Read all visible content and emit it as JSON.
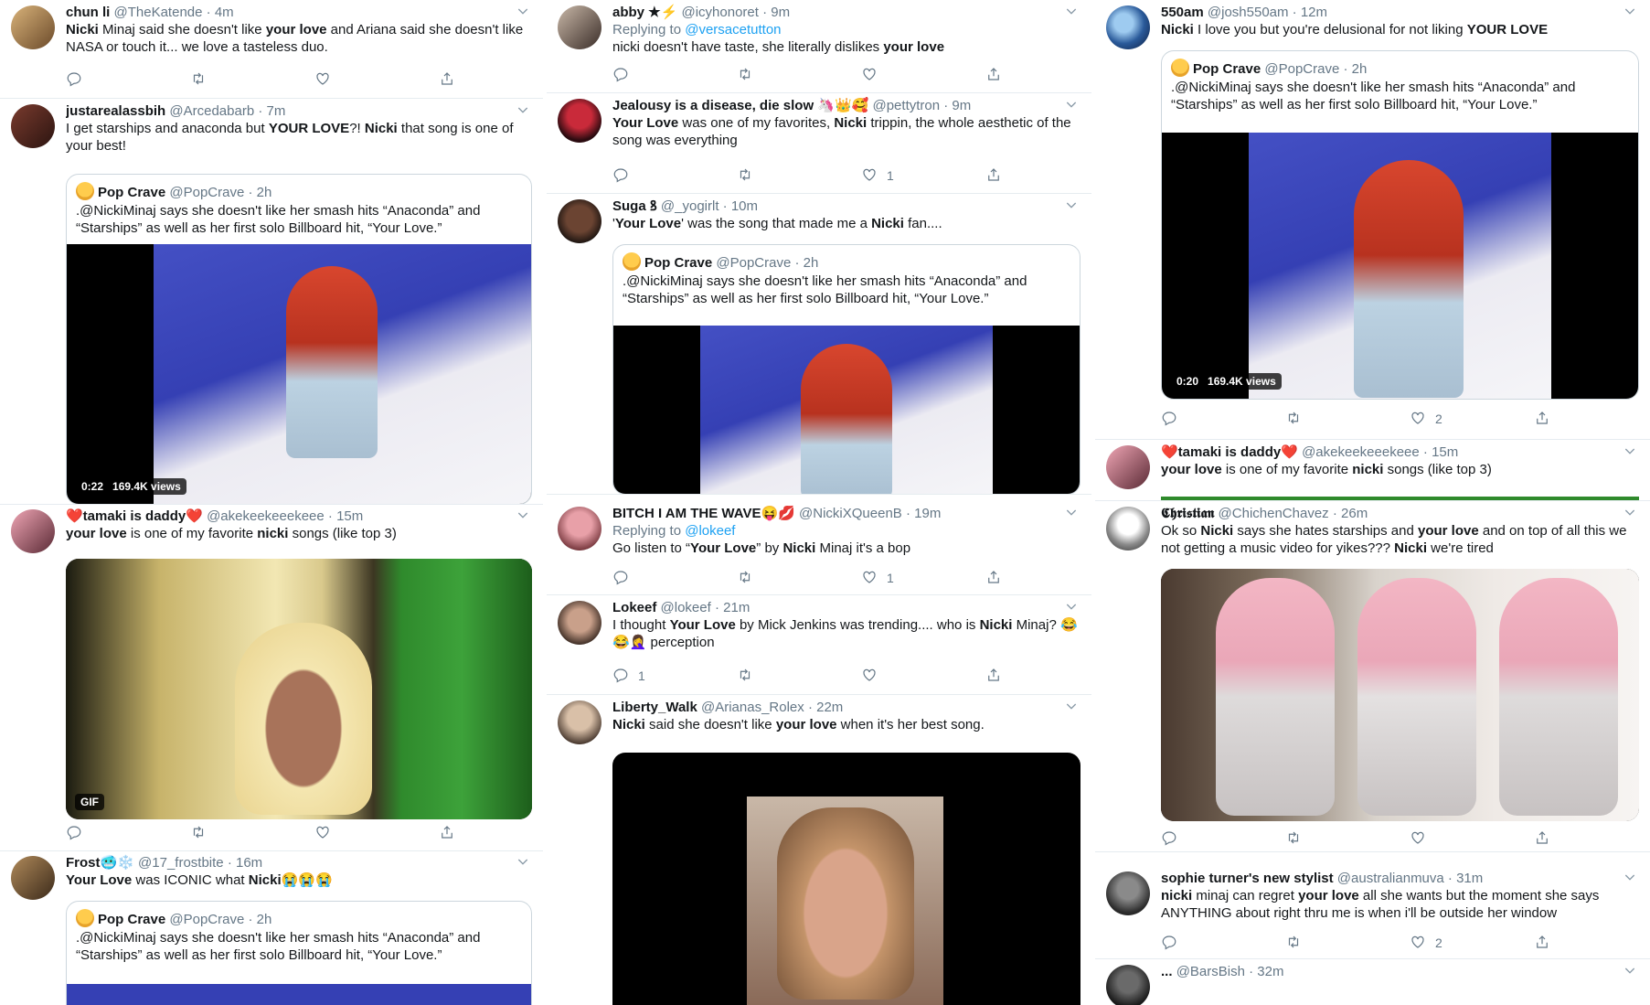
{
  "columns": [
    {
      "tweets": [
        {
          "name": "chun li",
          "handle": "@TheKatende",
          "time": "4m",
          "text": "Nicki Minaj said she doesn't like your love and Ariana said she doesn't like NASA or touch it... we love a tasteless duo.",
          "bold": [
            "Nicki",
            "your love"
          ]
        },
        {
          "name": "justarealassbih",
          "handle": "@Arcedabarb",
          "time": "7m",
          "text": "I get starships and anaconda but YOUR LOVE?! Nicki that song is one of your best!",
          "bold": [
            "YOUR LOVE",
            "Nicki"
          ],
          "quote": {
            "name": "Pop Crave",
            "handle": "@PopCrave",
            "time": "2h",
            "text": ".@NickiMinaj says she doesn't like her smash hits “Anaconda” and “Starships” as well as her first solo Billboard hit, “Your Love.”"
          },
          "media": {
            "badge_time": "0:22",
            "badge_views": "169.4K views"
          }
        },
        {
          "name": "❤️tamaki is daddy❤️",
          "handle": "@akekeekeeekeee",
          "time": "15m",
          "text": "your love is one of my favorite nicki songs (like top 3)",
          "bold": [
            "your love",
            "nicki"
          ],
          "media": {
            "badge": "GIF"
          }
        },
        {
          "name": "Frost🥶❄️",
          "handle": "@17_frostbite",
          "time": "16m",
          "text": "Your Love was ICONIC what Nicki😭😭😭",
          "bold": [
            "Your Love",
            "Nicki"
          ],
          "quote": {
            "name": "Pop Crave",
            "handle": "@PopCrave",
            "time": "2h",
            "text": ".@NickiMinaj says she doesn't like her smash hits “Anaconda” and “Starships” as well as her first solo Billboard hit, “Your Love.”"
          }
        }
      ]
    },
    {
      "tweets": [
        {
          "name": "abby ★⚡",
          "handle": "@icyhonoret",
          "time": "9m",
          "reply": "@versacetutton",
          "text": "nicki doesn't have taste, she literally dislikes your love",
          "bold": [
            "your love"
          ]
        },
        {
          "name": "Jealousy is a disease, die slow 🦄👑🥰",
          "handle": "@pettytron",
          "time": "9m",
          "text": "Your Love was one of my favorites, Nicki trippin, the whole aesthetic of the song was everything",
          "bold": [
            "Your Love",
            "Nicki"
          ],
          "likes": "1"
        },
        {
          "name": "Suga ꝸ",
          "handle": "@_yogirlt",
          "time": "10m",
          "text": "'Your Love' was the song that made me a Nicki fan....",
          "bold": [
            "Your Love",
            "Nicki"
          ],
          "quote": {
            "name": "Pop Crave",
            "handle": "@PopCrave",
            "time": "2h",
            "text": ".@NickiMinaj says she doesn't like her smash hits “Anaconda” and “Starships” as well as her first solo Billboard hit, “Your Love.”"
          }
        },
        {
          "name": "BITCH I AM THE WAVE😝💋",
          "handle": "@NickiXQueenB",
          "time": "19m",
          "reply": "@lokeef",
          "text": "Go listen to “Your Love” by Nicki Minaj it's a bop",
          "bold": [
            "Your Love",
            "Nicki"
          ],
          "likes": "1"
        },
        {
          "name": "Lokeef",
          "handle": "@lokeef",
          "time": "21m",
          "text": "I thought Your Love by Mick Jenkins was trending.... who is Nicki Minaj? 😂 😂🤦‍♀️ perception",
          "bold": [
            "Your Love",
            "Nicki"
          ],
          "replies": "1"
        },
        {
          "name": "Liberty_Walk",
          "handle": "@Arianas_Rolex",
          "time": "22m",
          "text": "Nicki said she doesn't like your love when it's her best song.",
          "bold": [
            "Nicki",
            "your love"
          ]
        }
      ]
    },
    {
      "tweets": [
        {
          "name": "550am",
          "handle": "@josh550am",
          "time": "12m",
          "text": "Nicki I love you but you're delusional for not liking YOUR LOVE",
          "bold": [
            "Nicki",
            "YOUR LOVE"
          ],
          "quote": {
            "name": "Pop Crave",
            "handle": "@PopCrave",
            "time": "2h",
            "text": ".@NickiMinaj says she doesn't like her smash hits “Anaconda” and “Starships” as well as her first solo Billboard hit, “Your Love.”"
          },
          "media": {
            "badge_time": "0:20",
            "badge_views": "169.4K views"
          },
          "likes": "2"
        },
        {
          "name": "❤️tamaki is daddy❤️",
          "handle": "@akekeekeeekeee",
          "time": "15m",
          "text": "your love is one of my favorite nicki songs (like top 3)",
          "bold": [
            "your love",
            "nicki"
          ]
        },
        {
          "name": "𝕮𝖍𝖗𝖎𝖘𝖙𝖎𝖆𝖓",
          "handle": "@ChichenChavez",
          "time": "26m",
          "text": "Ok so Nicki says she hates starships and your love and on top of all this we not getting a music video for yikes??? Nicki we're tired",
          "bold": [
            "Nicki",
            "your love"
          ]
        },
        {
          "name": "sophie turner's new stylist",
          "handle": "@australianmuva",
          "time": "31m",
          "text": "nicki minaj can regret your love all she wants but the moment she says ANYTHING about right thru me is when i'll be outside her window",
          "bold": [
            "nicki",
            "your love"
          ],
          "likes": "2"
        },
        {
          "name": "...",
          "handle": "@BarsBish",
          "time": "32m",
          "text": ""
        }
      ]
    }
  ],
  "labels": {
    "replying_to": "Replying to",
    "dot": "·"
  },
  "colors": {
    "link": "#1da1f2",
    "secondary": "#657786",
    "border": "#e6ecf0",
    "quote_border": "#ccd6dd"
  }
}
